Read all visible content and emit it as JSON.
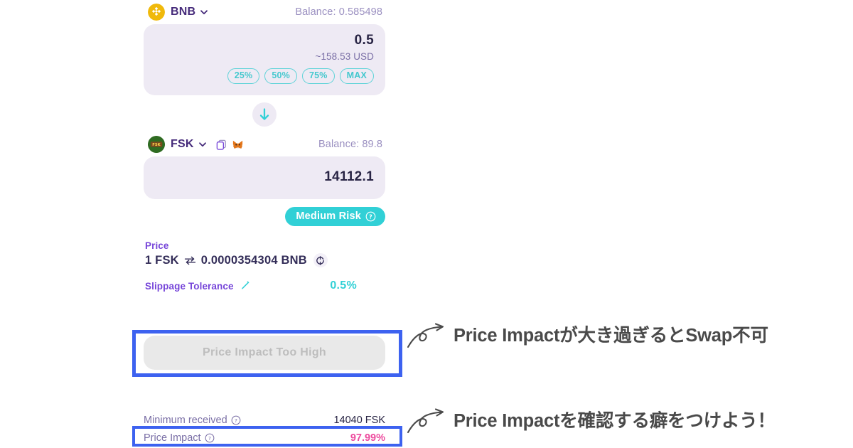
{
  "swap": {
    "from": {
      "token_symbol": "BNB",
      "token_icon": "bnb-token-icon",
      "balance_label": "Balance: 0.585498",
      "amount": "0.5",
      "usd_estimate": "~158.53 USD",
      "percent_buttons": [
        "25%",
        "50%",
        "75%",
        "MAX"
      ]
    },
    "swap_direction_icon": "arrow-down-icon",
    "to": {
      "token_symbol": "FSK",
      "token_icon": "fsk-token-icon",
      "copy_icon": "copy-icon",
      "wallet_icon": "metamask-fox-icon",
      "balance_label": "Balance: 89.8",
      "amount": "14112.1"
    },
    "risk_badge": {
      "label": "Medium Risk",
      "help_icon": "question-circle-icon"
    },
    "price": {
      "label": "Price",
      "base": "1 FSK",
      "swap_icon": "exchange-arrows-icon",
      "quote": "0.0000354304 BNB",
      "refresh_icon": "refresh-icon"
    },
    "slippage": {
      "label": "Slippage Tolerance",
      "edit_icon": "pencil-edit-icon",
      "value": "0.5%"
    },
    "action_button": {
      "label": "Price Impact Too High",
      "disabled": true
    },
    "details": [
      {
        "label": "Minimum received",
        "help_icon": "question-circle-icon",
        "value": "14040 FSK",
        "highlight": false
      },
      {
        "label": "Price Impact",
        "help_icon": "question-circle-icon",
        "value": "97.99%",
        "highlight": true
      }
    ]
  },
  "annotations": [
    {
      "text": "Price Impactが大き過ぎるとSwap不可",
      "arrow_icon": "curved-arrow-icon"
    },
    {
      "text": "Price Impactを確認する癖をつけよう！",
      "arrow_icon": "curved-arrow-icon"
    }
  ],
  "colors": {
    "accent_purple": "#7645d9",
    "accent_teal": "#31d0d6",
    "panel_bg": "#eeeaf4",
    "highlight_blue": "#3d62f0",
    "pink": "#ed4b9e",
    "disabled_grey": "#e9e9e9",
    "text_dark": "#282444",
    "text_muted": "#7a6fa6"
  }
}
